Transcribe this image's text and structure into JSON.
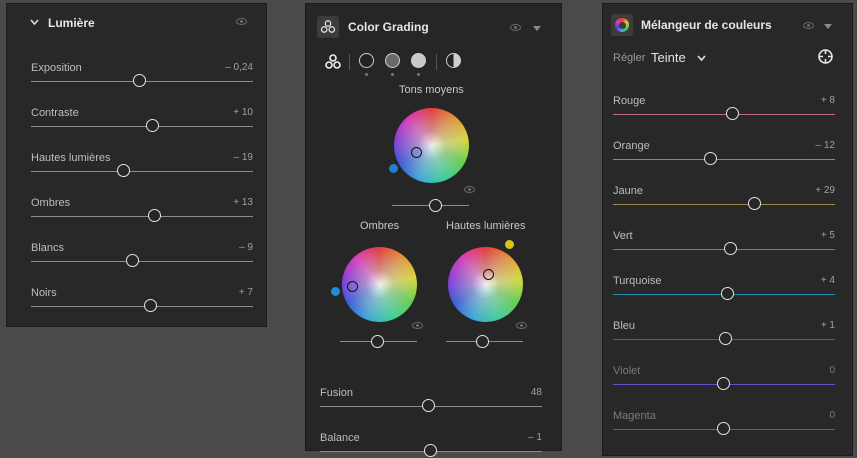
{
  "light": {
    "title": "Lumière",
    "sliders": [
      {
        "label": "Exposition",
        "value": "– 0,24",
        "pos": 0.49
      },
      {
        "label": "Contraste",
        "value": "+ 10",
        "pos": 0.55
      },
      {
        "label": "Hautes lumières",
        "value": "– 19",
        "pos": 0.42
      },
      {
        "label": "Ombres",
        "value": "+ 13",
        "pos": 0.56
      },
      {
        "label": "Blancs",
        "value": "– 9",
        "pos": 0.46
      },
      {
        "label": "Noirs",
        "value": "+ 7",
        "pos": 0.54
      }
    ]
  },
  "grading": {
    "title": "Color Grading",
    "midtones_label": "Tons moyens",
    "shadows_label": "Ombres",
    "highlights_label": "Hautes lumières",
    "sliders": [
      {
        "label": "Fusion",
        "value": "48",
        "pos": 0.49
      },
      {
        "label": "Balance",
        "value": "– 1",
        "pos": 0.5
      }
    ]
  },
  "mixer": {
    "title": "Mélangeur de couleurs",
    "adjust_label": "Régler",
    "adjust_value": "Teinte",
    "sliders": [
      {
        "label": "Rouge",
        "value": "+ 8",
        "pos": 0.54,
        "color": "#c06a8a"
      },
      {
        "label": "Orange",
        "value": "– 12",
        "pos": 0.44,
        "color": "#b06cb0"
      },
      {
        "label": "Jaune",
        "value": "+ 29",
        "pos": 0.64,
        "color": "#9a8a4a"
      },
      {
        "label": "Vert",
        "value": "+ 5",
        "pos": 0.53,
        "color": "#3aa07a"
      },
      {
        "label": "Turquoise",
        "value": "+ 4",
        "pos": 0.52,
        "color": "#2a8ab0"
      },
      {
        "label": "Bleu",
        "value": "+ 1",
        "pos": 0.51,
        "color": "#3a5ac8"
      },
      {
        "label": "Violet",
        "value": "0",
        "pos": 0.5,
        "color": "#6a4ac8",
        "dim": true
      },
      {
        "label": "Magenta",
        "value": "0",
        "pos": 0.5,
        "color": "#9a3aa8",
        "dim": true
      }
    ]
  },
  "colors": {
    "shadow_dot": "#1e8fd6",
    "highlight_dot": "#d9c41c",
    "midtone_dot": "#1f7fd4"
  }
}
